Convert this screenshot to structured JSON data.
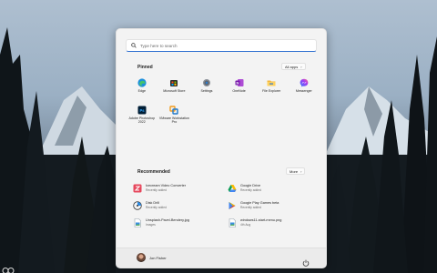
{
  "search": {
    "placeholder": "Type here to search"
  },
  "pinned": {
    "title": "Pinned",
    "all_apps_label": "All apps",
    "apps": [
      {
        "label": "Edge",
        "icon": "edge-icon"
      },
      {
        "label": "Microsoft Store",
        "icon": "store-icon"
      },
      {
        "label": "Settings",
        "icon": "settings-icon"
      },
      {
        "label": "OneNote",
        "icon": "onenote-icon"
      },
      {
        "label": "File Explorer",
        "icon": "folder-icon"
      },
      {
        "label": "Messenger",
        "icon": "messenger-icon"
      },
      {
        "label": "Adobe Photoshop 2022",
        "icon": "photoshop-icon"
      },
      {
        "label": "VMware Workstation Pro",
        "icon": "vmware-icon"
      }
    ]
  },
  "recommended": {
    "title": "Recommended",
    "more_label": "More",
    "items": [
      {
        "name": "Icecream Video Converter",
        "sub": "Recently added",
        "icon": "icecream-icon"
      },
      {
        "name": "Google Drive",
        "sub": "Recently added",
        "icon": "google-drive-icon"
      },
      {
        "name": "Disk Drill",
        "sub": "Recently added",
        "icon": "disk-drill-icon"
      },
      {
        "name": "Google Play Games beta",
        "sub": "Recently added",
        "icon": "play-games-icon"
      },
      {
        "name": "Unsplash-Pavel-Bendery.jpg",
        "sub": "Images",
        "icon": "image-file-icon"
      },
      {
        "name": "windows11-start-menu.png",
        "sub": "4th Aug",
        "icon": "image-file-icon"
      }
    ]
  },
  "user": {
    "name": "Jon Fisher"
  },
  "colors": {
    "accent": "#2e6fd0",
    "menu_bg": "#f3f3f3"
  }
}
